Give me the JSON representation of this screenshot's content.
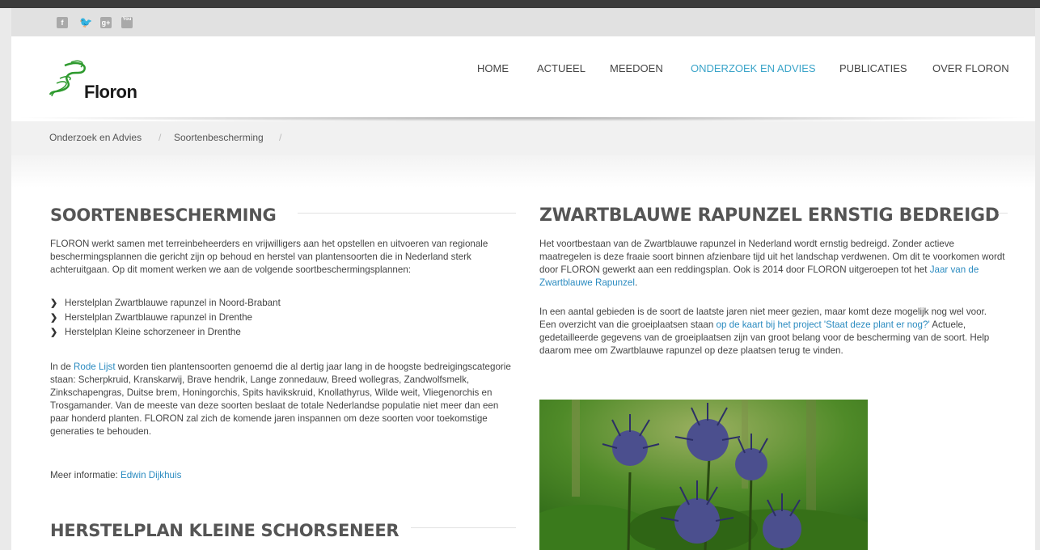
{
  "social": {
    "icons": [
      {
        "name": "facebook-icon",
        "glyph": "f"
      },
      {
        "name": "twitter-icon",
        "glyph": "t"
      },
      {
        "name": "googleplus-icon",
        "glyph": "g+"
      },
      {
        "name": "youtube-icon",
        "glyph": "You"
      }
    ]
  },
  "brand": {
    "name": "Floron",
    "logo_color": "#2e9a2e"
  },
  "nav": {
    "items": [
      {
        "label": "HOME"
      },
      {
        "label": "ACTUEEL"
      },
      {
        "label": "MEEDOEN"
      },
      {
        "label": "ONDERZOEK EN ADVIES",
        "active": true
      },
      {
        "label": "PUBLICATIES"
      },
      {
        "label": "OVER FLORON"
      }
    ],
    "active_color": "#3aa4c9"
  },
  "breadcrumb": {
    "items": [
      "Onderzoek en Advies",
      "Soortenbescherming"
    ],
    "separator": "/"
  },
  "left": {
    "title": "SOORTENBESCHERMING",
    "intro": "FLORON werkt samen met terreinbeheerders en vrijwilligers aan het opstellen en uitvoeren van regionale beschermingsplannen die gericht zijn op behoud en herstel van plantensoorten die in Nederland sterk achteruitgaan. Op dit moment werken we aan de volgende soortbeschermingsplannen:",
    "plans": [
      "Herstelplan Zwartblauwe rapunzel in Noord-Brabant",
      "Herstelplan Zwartblauwe rapunzel in Drenthe",
      "Herstelplan Kleine schorzeneer in Drenthe"
    ],
    "rode_pre": "In de ",
    "rode_link": "Rode Lijst",
    "rode_post": " worden tien plantensoorten genoemd die al dertig jaar lang in de hoogste bedreigingscategorie staan:  Scherpkruid, Kranskarwij, Brave hendrik, Lange zonnedauw, Breed wollegras, Zandwolfsmelk, Zinkschapengras, Duitse brem, Honingorchis, Spits havikskruid, Knollathyrus, Wilde weit, Vliegenorchis en Trosgamander. Van de meeste van deze soorten beslaat de totale Nederlandse populatie niet meer dan een paar honderd planten. FLORON zal zich de komende jaren inspannen om deze soorten voor toekomstige generaties te behouden.",
    "more_label": "Meer informatie: ",
    "more_link": "Edwin Dijkhuis",
    "title2": "HERSTELPLAN KLEINE SCHORSENEER"
  },
  "right": {
    "title": "ZWARTBLAUWE RAPUNZEL ERNSTIG BEDREIGD",
    "p1_pre": "Het voortbestaan van de Zwartblauwe rapunzel in Nederland wordt ernstig bedreigd. Zonder actieve maatregelen is deze fraaie soort binnen afzienbare tijd uit het landschap verdwenen. Om dit te voorkomen wordt door FLORON gewerkt aan een reddingsplan. Ook is 2014 door FLORON uitgeroepen tot het ",
    "p1_link": "Jaar van de Zwartblauwe Rapunzel",
    "p1_post": ".",
    "p2_pre": "In een aantal gebieden is de soort de laatste jaren niet meer gezien, maar komt deze mogelijk nog wel voor. Een overzicht van die groeiplaatsen staan ",
    "p2_link": "op de kaart bij het project 'Staat deze plant er nog?'",
    "p2_post": " Actuele, gedetailleerde gegevens van de groeiplaatsen zijn van groot belang voor de bescherming van de soort. Help daarom mee om Zwartblauwe rapunzel op deze plaatsen terug te vinden."
  },
  "colors": {
    "link": "#2b8bc0",
    "heading": "#555555"
  }
}
